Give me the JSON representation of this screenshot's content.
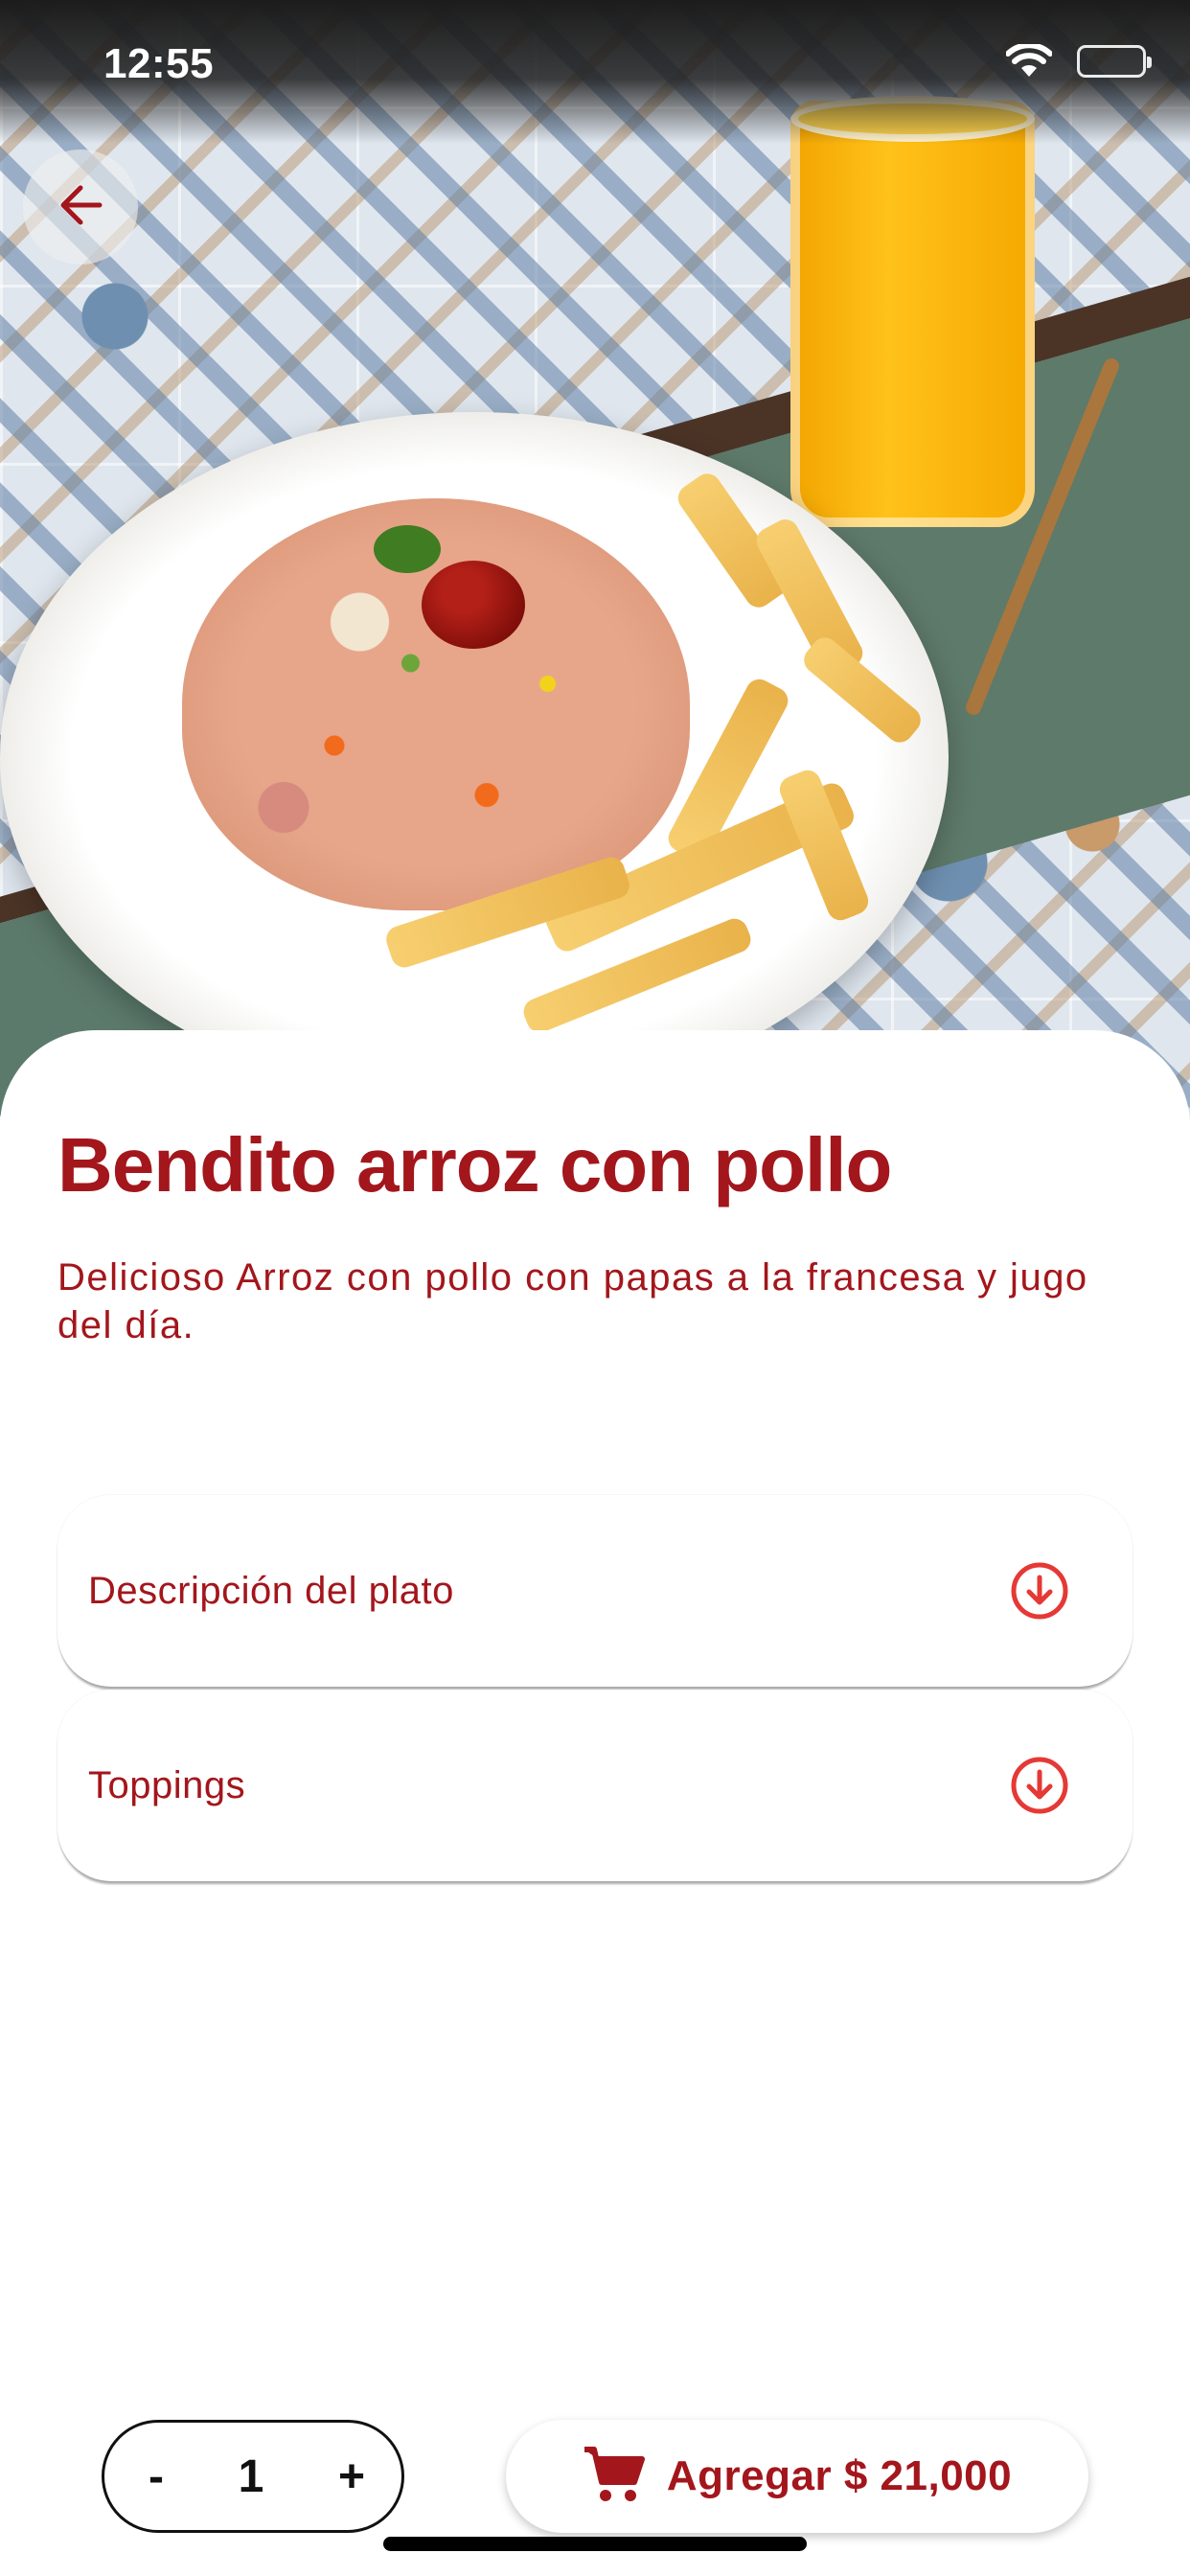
{
  "status_bar": {
    "time": "12:55"
  },
  "dish": {
    "title": "Bendito arroz con pollo",
    "description": "Delicioso Arroz con pollo con papas a la francesa y jugo del día."
  },
  "sections": [
    {
      "label": "Descripción del plato",
      "icon": "arrow-circle-down-icon"
    },
    {
      "label": "Toppings",
      "icon": "arrow-circle-down-icon"
    }
  ],
  "quantity": {
    "decrement_label": "-",
    "value": "1",
    "increment_label": "+"
  },
  "cart_button": {
    "label": "Agregar $ 21,000",
    "icon": "cart-icon"
  },
  "icons": {
    "back": "arrow-left-icon"
  },
  "colors": {
    "accent": "#a3161c",
    "icon_red": "#e53935"
  }
}
